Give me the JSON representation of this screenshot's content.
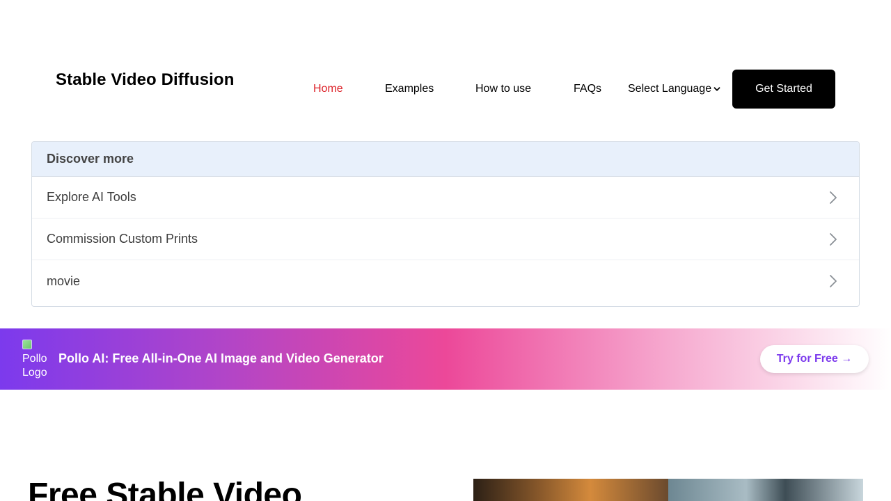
{
  "header": {
    "site_title": "Stable Video Diffusion",
    "nav": {
      "home": "Home",
      "examples": "Examples",
      "how_to_use": "How to use",
      "faqs": "FAQs"
    },
    "language_select": "Select Language",
    "get_started": "Get Started"
  },
  "discover": {
    "heading": "Discover more",
    "items": [
      {
        "label": "Explore AI Tools"
      },
      {
        "label": "Commission Custom Prints"
      },
      {
        "label": "movie"
      }
    ]
  },
  "promo": {
    "logo_alt": "Pollo Logo",
    "text": "Pollo AI: Free All-in-One AI Image and Video Generator",
    "button": "Try for Free →"
  },
  "hero": {
    "title": "Free Stable Video"
  },
  "colors": {
    "nav_active": "#dc1f26",
    "cta_bg": "#000000",
    "promo_accent": "#7c3aed",
    "discover_head_bg": "#e8f0fb"
  },
  "icons": {
    "language_chevron": "chevron-down-icon",
    "discover_chevron": "chevron-right-icon",
    "promo_logo": "broken-image-icon"
  }
}
